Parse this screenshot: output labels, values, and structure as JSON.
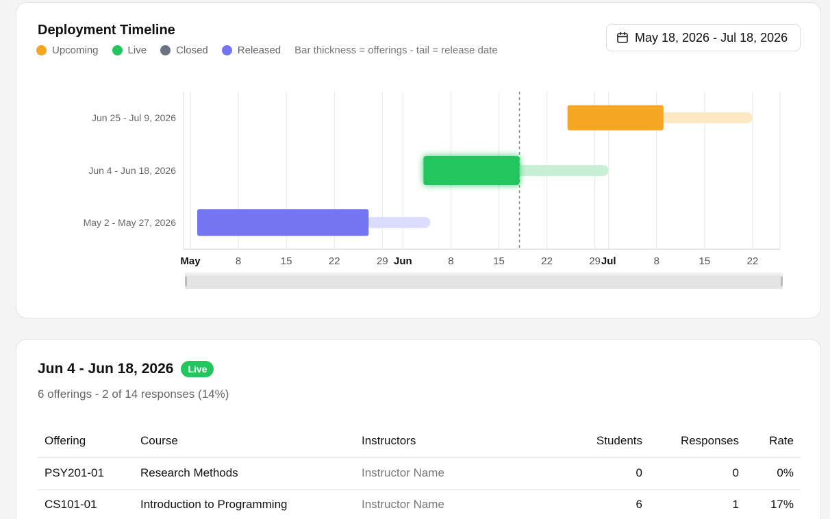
{
  "timeline": {
    "title": "Deployment Timeline",
    "legend": [
      {
        "label": "Upcoming",
        "color": "#f5a623"
      },
      {
        "label": "Live",
        "color": "#22c55e"
      },
      {
        "label": "Closed",
        "color": "#6b7280"
      },
      {
        "label": "Released",
        "color": "#7475f0"
      }
    ],
    "legend_note": "Bar thickness = offerings - tail = release date",
    "date_range": "May 18, 2026 - Jul 18, 2026",
    "icon": "calendar-icon"
  },
  "chart_data": {
    "type": "gantt",
    "x_ticks": [
      {
        "label": "May",
        "date": "2026-05-01",
        "major": true
      },
      {
        "label": "8",
        "date": "2026-05-08",
        "major": false
      },
      {
        "label": "15",
        "date": "2026-05-15",
        "major": false
      },
      {
        "label": "22",
        "date": "2026-05-22",
        "major": false
      },
      {
        "label": "29",
        "date": "2026-05-29",
        "major": false
      },
      {
        "label": "Jun",
        "date": "2026-06-01",
        "major": true
      },
      {
        "label": "8",
        "date": "2026-06-08",
        "major": false
      },
      {
        "label": "15",
        "date": "2026-06-15",
        "major": false
      },
      {
        "label": "22",
        "date": "2026-06-22",
        "major": false
      },
      {
        "label": "29",
        "date": "2026-06-29",
        "major": false
      },
      {
        "label": "Jul",
        "date": "2026-07-01",
        "major": true
      },
      {
        "label": "8",
        "date": "2026-07-08",
        "major": false
      },
      {
        "label": "15",
        "date": "2026-07-15",
        "major": false
      },
      {
        "label": "22",
        "date": "2026-07-22",
        "major": false
      }
    ],
    "x_range": [
      "2026-04-30",
      "2026-07-26"
    ],
    "today": "2026-06-18",
    "rows": [
      {
        "label": "Jun 25 - Jul 9, 2026",
        "start": "2026-06-25",
        "end": "2026-07-09",
        "release": "2026-07-22",
        "status": "Upcoming",
        "color": "#f5a623",
        "tail_color": "#fde8c4",
        "offerings": 4
      },
      {
        "label": "Jun 4 - Jun 18, 2026",
        "start": "2026-06-04",
        "end": "2026-06-18",
        "release": "2026-07-01",
        "status": "Live",
        "color": "#22c55e",
        "tail_color": "#c8f0d6",
        "offerings": 6
      },
      {
        "label": "May 2 - May 27, 2026",
        "start": "2026-05-02",
        "end": "2026-05-27",
        "release": "2026-06-05",
        "status": "Released",
        "color": "#7475f0",
        "tail_color": "#dcdcfc",
        "offerings": 5
      }
    ]
  },
  "detail": {
    "title": "Jun 4 - Jun 18, 2026",
    "badge": "Live",
    "subtitle": "6 offerings - 2 of 14 responses (14%)",
    "columns": [
      "Offering",
      "Course",
      "Instructors",
      "Students",
      "Responses",
      "Rate"
    ],
    "rows": [
      {
        "offering": "PSY201-01",
        "course": "Research Methods",
        "instructors": "Instructor Name",
        "students": "0",
        "responses": "0",
        "rate": "0%"
      },
      {
        "offering": "CS101-01",
        "course": "Introduction to Programming",
        "instructors": "Instructor Name",
        "students": "6",
        "responses": "1",
        "rate": "17%"
      }
    ]
  }
}
